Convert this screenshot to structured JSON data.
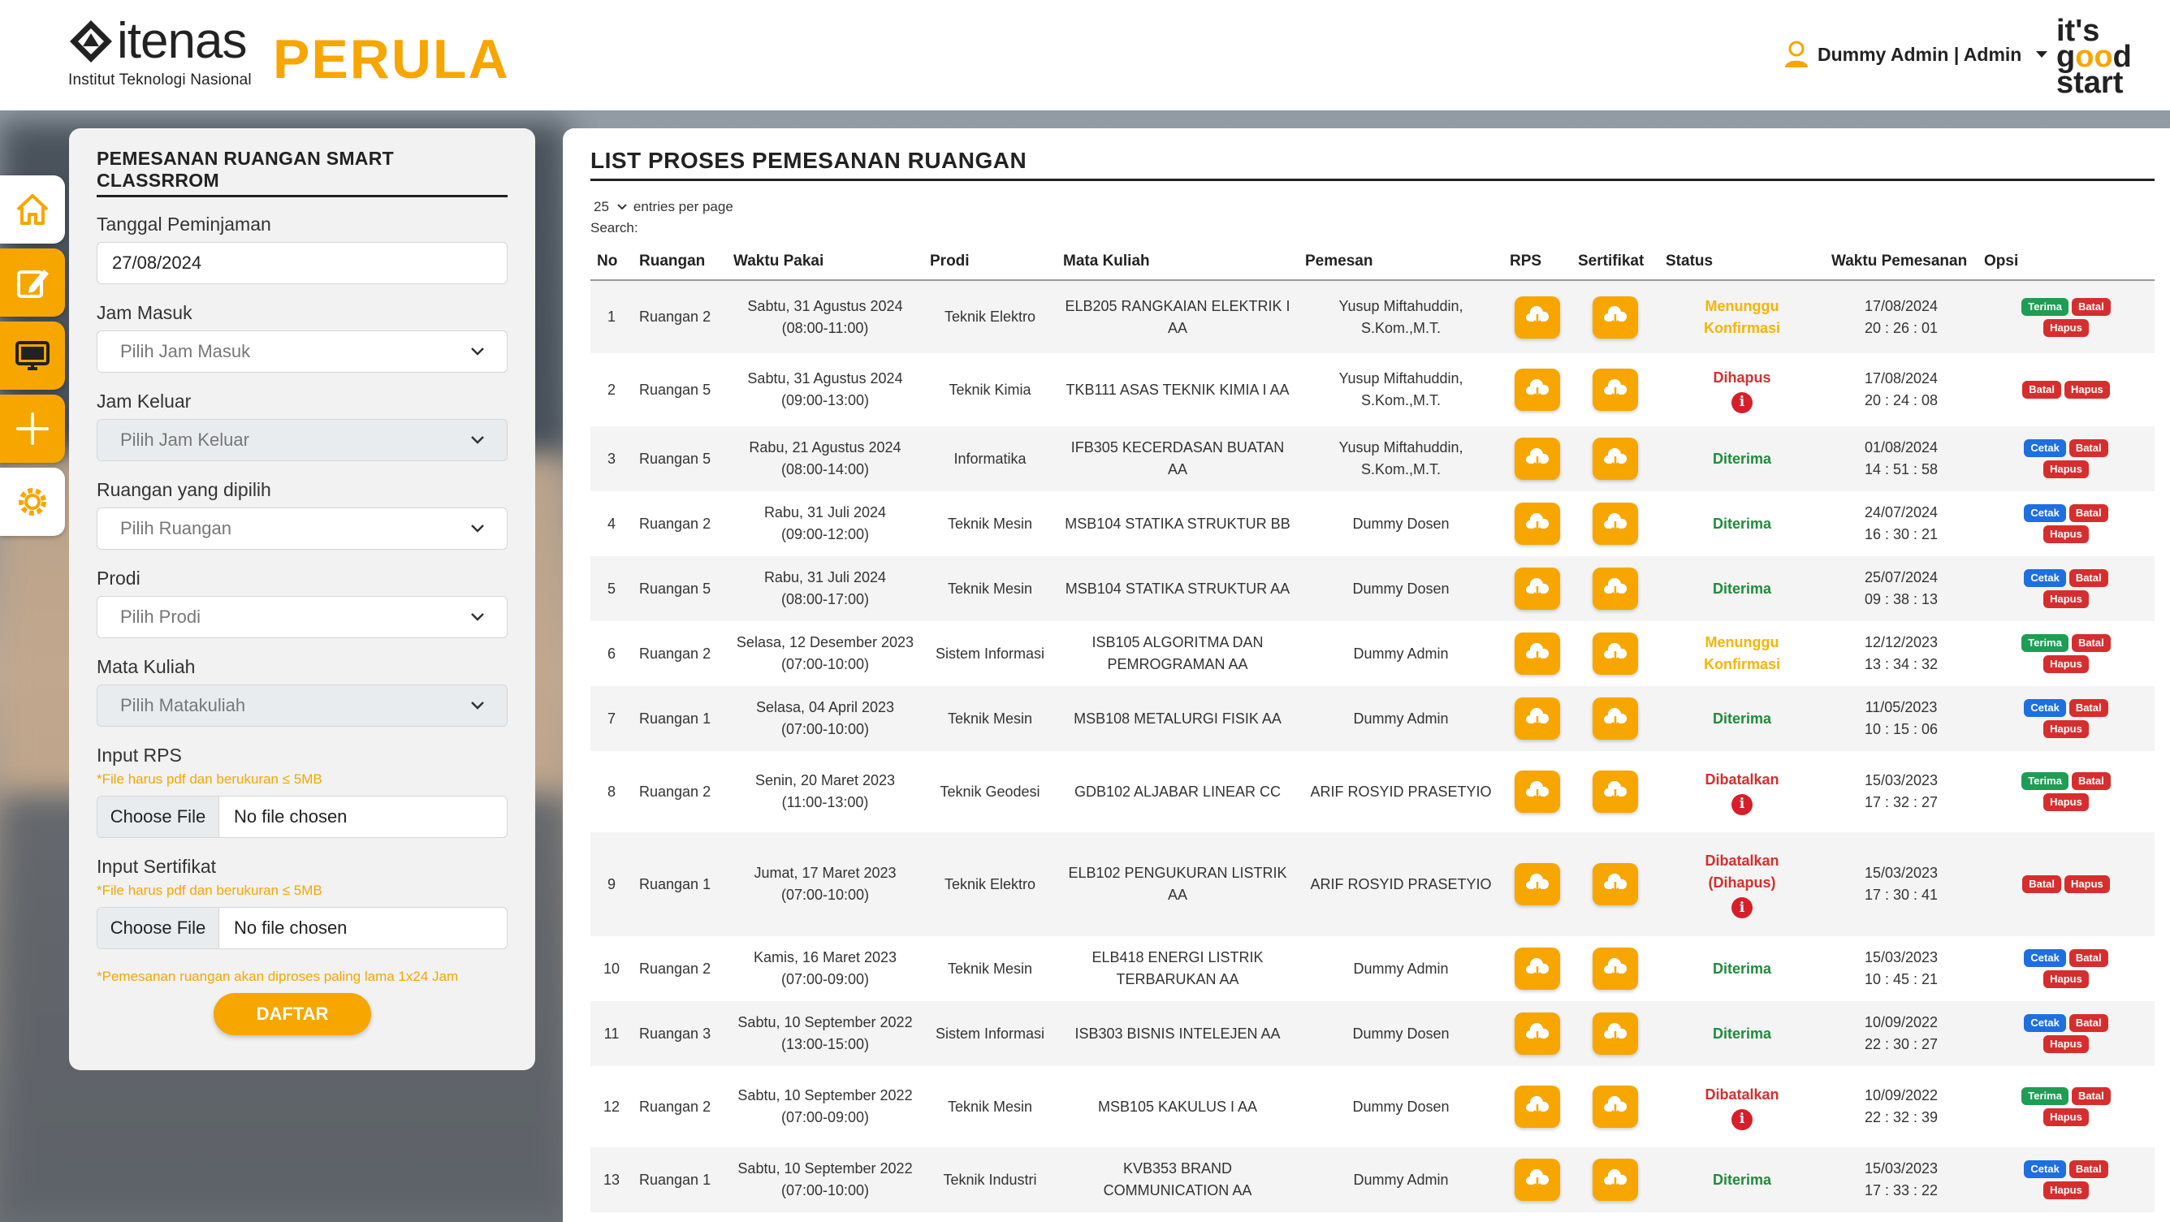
{
  "header": {
    "logo_text": "itenas",
    "logo_subtitle": "Institut Teknologi Nasional",
    "app_title": "PERULA",
    "user_label": "Dummy Admin | Admin",
    "slogan": [
      "it's",
      "good",
      "start"
    ]
  },
  "sidenav": {
    "items": [
      {
        "icon": "home-icon"
      },
      {
        "icon": "edit-icon",
        "active": true
      },
      {
        "icon": "monitor-icon"
      },
      {
        "icon": "plus-icon"
      },
      {
        "icon": "gear-icon"
      }
    ]
  },
  "form": {
    "title": "PEMESANAN RUANGAN SMART CLASSRROM",
    "tanggal_label": "Tanggal Peminjaman",
    "tanggal_value": "27/08/2024",
    "jam_masuk_label": "Jam Masuk",
    "jam_masuk_placeholder": "Pilih Jam Masuk",
    "jam_keluar_label": "Jam Keluar",
    "jam_keluar_placeholder": "Pilih Jam Keluar",
    "ruangan_label": "Ruangan yang dipilih",
    "ruangan_placeholder": "Pilih Ruangan",
    "prodi_label": "Prodi",
    "prodi_placeholder": "Pilih Prodi",
    "matkul_label": "Mata Kuliah",
    "matkul_placeholder": "Pilih Matakuliah",
    "rps_label": "Input RPS",
    "rps_hint": "*File harus pdf dan berukuran ≤ 5MB",
    "sertifikat_label": "Input Sertifikat",
    "sertifikat_hint": "*File harus pdf dan berukuran ≤ 5MB",
    "choose_file": "Choose File",
    "no_file": "No file chosen",
    "note": "*Pemesanan ruangan akan diproses paling lama 1x24 Jam",
    "submit_label": "DAFTAR"
  },
  "list": {
    "title": "LIST PROSES PEMESANAN RUANGAN",
    "entries_value": "25",
    "entries_label": "entries per page",
    "search_label": "Search:",
    "columns": [
      "No",
      "Ruangan",
      "Waktu Pakai",
      "Prodi",
      "Mata Kuliah",
      "Pemesan",
      "RPS",
      "Sertifikat",
      "Status",
      "Waktu Pemesanan",
      "Opsi"
    ],
    "rows": [
      {
        "no": "1",
        "ruangan": "Ruangan 2",
        "waktu": [
          "Sabtu, 31 Agustus 2024",
          "(08:00-11:00)"
        ],
        "prodi": "Teknik Elektro",
        "matkul": [
          "ELB205 RANGKAIAN ELEKTRIK I",
          "AA"
        ],
        "pemesan": [
          "Yusup Miftahuddin,",
          "S.Kom.,M.T."
        ],
        "status": [
          "Menunggu",
          "Konfirmasi"
        ],
        "status_type": "wait",
        "info": false,
        "pesan": [
          "17/08/2024",
          "20 : 26 : 01"
        ],
        "opsi": [
          "Terima",
          "Batal",
          "Hapus"
        ]
      },
      {
        "no": "2",
        "ruangan": "Ruangan 5",
        "waktu": [
          "Sabtu, 31 Agustus 2024",
          "(09:00-13:00)"
        ],
        "prodi": "Teknik Kimia",
        "matkul": [
          "TKB111 ASAS TEKNIK KIMIA I AA"
        ],
        "pemesan": [
          "Yusup Miftahuddin,",
          "S.Kom.,M.T."
        ],
        "status": [
          "Dihapus"
        ],
        "status_type": "bad",
        "info": true,
        "pesan": [
          "17/08/2024",
          "20 : 24 : 08"
        ],
        "opsi": [
          "Batal",
          "Hapus"
        ]
      },
      {
        "no": "3",
        "ruangan": "Ruangan 5",
        "waktu": [
          "Rabu, 21 Agustus 2024",
          "(08:00-14:00)"
        ],
        "prodi": "Informatika",
        "matkul": [
          "IFB305 KECERDASAN BUATAN",
          "AA"
        ],
        "pemesan": [
          "Yusup Miftahuddin,",
          "S.Kom.,M.T."
        ],
        "status": [
          "Diterima"
        ],
        "status_type": "ok",
        "info": false,
        "pesan": [
          "01/08/2024",
          "14 : 51 : 58"
        ],
        "opsi": [
          "Cetak",
          "Batal",
          "Hapus"
        ]
      },
      {
        "no": "4",
        "ruangan": "Ruangan 2",
        "waktu": [
          "Rabu, 31 Juli 2024",
          "(09:00-12:00)"
        ],
        "prodi": "Teknik Mesin",
        "matkul": [
          "MSB104 STATIKA STRUKTUR BB"
        ],
        "pemesan": [
          "Dummy Dosen"
        ],
        "status": [
          "Diterima"
        ],
        "status_type": "ok",
        "info": false,
        "pesan": [
          "24/07/2024",
          "16 : 30 : 21"
        ],
        "opsi": [
          "Cetak",
          "Batal",
          "Hapus"
        ]
      },
      {
        "no": "5",
        "ruangan": "Ruangan 5",
        "waktu": [
          "Rabu, 31 Juli 2024",
          "(08:00-17:00)"
        ],
        "prodi": "Teknik Mesin",
        "matkul": [
          "MSB104 STATIKA STRUKTUR AA"
        ],
        "pemesan": [
          "Dummy Dosen"
        ],
        "status": [
          "Diterima"
        ],
        "status_type": "ok",
        "info": false,
        "pesan": [
          "25/07/2024",
          "09 : 38 : 13"
        ],
        "opsi": [
          "Cetak",
          "Batal",
          "Hapus"
        ]
      },
      {
        "no": "6",
        "ruangan": "Ruangan 2",
        "waktu": [
          "Selasa, 12 Desember 2023",
          "(07:00-10:00)"
        ],
        "prodi": "Sistem Informasi",
        "matkul": [
          "ISB105 ALGORITMA DAN",
          "PEMROGRAMAN AA"
        ],
        "pemesan": [
          "Dummy Admin"
        ],
        "status": [
          "Menunggu",
          "Konfirmasi"
        ],
        "status_type": "wait",
        "info": false,
        "pesan": [
          "12/12/2023",
          "13 : 34 : 32"
        ],
        "opsi": [
          "Terima",
          "Batal",
          "Hapus"
        ]
      },
      {
        "no": "7",
        "ruangan": "Ruangan 1",
        "waktu": [
          "Selasa, 04 April 2023",
          "(07:00-10:00)"
        ],
        "prodi": "Teknik Mesin",
        "matkul": [
          "MSB108 METALURGI FISIK AA"
        ],
        "pemesan": [
          "Dummy Admin"
        ],
        "status": [
          "Diterima"
        ],
        "status_type": "ok",
        "info": false,
        "pesan": [
          "11/05/2023",
          "10 : 15 : 06"
        ],
        "opsi": [
          "Cetak",
          "Batal",
          "Hapus"
        ]
      },
      {
        "no": "8",
        "ruangan": "Ruangan 2",
        "waktu": [
          "Senin, 20 Maret 2023",
          "(11:00-13:00)"
        ],
        "prodi": "Teknik Geodesi",
        "matkul": [
          "GDB102 ALJABAR LINEAR CC"
        ],
        "pemesan": [
          "ARIF ROSYID PRASETYIO"
        ],
        "status": [
          "Dibatalkan"
        ],
        "status_type": "bad",
        "info": true,
        "pesan": [
          "15/03/2023",
          "17 : 32 : 27"
        ],
        "opsi": [
          "Terima",
          "Batal",
          "Hapus"
        ]
      },
      {
        "no": "9",
        "ruangan": "Ruangan 1",
        "waktu": [
          "Jumat, 17 Maret 2023",
          "(07:00-10:00)"
        ],
        "prodi": "Teknik Elektro",
        "matkul": [
          "ELB102 PENGUKURAN LISTRIK",
          "AA"
        ],
        "pemesan": [
          "ARIF ROSYID PRASETYIO"
        ],
        "status": [
          "Dibatalkan",
          "(Dihapus)"
        ],
        "status_type": "bad",
        "info": true,
        "pesan": [
          "15/03/2023",
          "17 : 30 : 41"
        ],
        "opsi": [
          "Batal",
          "Hapus"
        ]
      },
      {
        "no": "10",
        "ruangan": "Ruangan 2",
        "waktu": [
          "Kamis, 16 Maret 2023",
          "(07:00-09:00)"
        ],
        "prodi": "Teknik Mesin",
        "matkul": [
          "ELB418 ENERGI LISTRIK",
          "TERBARUKAN AA"
        ],
        "pemesan": [
          "Dummy Admin"
        ],
        "status": [
          "Diterima"
        ],
        "status_type": "ok",
        "info": false,
        "pesan": [
          "15/03/2023",
          "10 : 45 : 21"
        ],
        "opsi": [
          "Cetak",
          "Batal",
          "Hapus"
        ]
      },
      {
        "no": "11",
        "ruangan": "Ruangan 3",
        "waktu": [
          "Sabtu, 10 September 2022",
          "(13:00-15:00)"
        ],
        "prodi": "Sistem Informasi",
        "matkul": [
          "ISB303 BISNIS INTELEJEN AA"
        ],
        "pemesan": [
          "Dummy Dosen"
        ],
        "status": [
          "Diterima"
        ],
        "status_type": "ok",
        "info": false,
        "pesan": [
          "10/09/2022",
          "22 : 30 : 27"
        ],
        "opsi": [
          "Cetak",
          "Batal",
          "Hapus"
        ]
      },
      {
        "no": "12",
        "ruangan": "Ruangan 2",
        "waktu": [
          "Sabtu, 10 September 2022",
          "(07:00-09:00)"
        ],
        "prodi": "Teknik Mesin",
        "matkul": [
          "MSB105 KAKULUS I AA"
        ],
        "pemesan": [
          "Dummy Dosen"
        ],
        "status": [
          "Dibatalkan"
        ],
        "status_type": "bad",
        "info": true,
        "pesan": [
          "10/09/2022",
          "22 : 32 : 39"
        ],
        "opsi": [
          "Terima",
          "Batal",
          "Hapus"
        ]
      },
      {
        "no": "13",
        "ruangan": "Ruangan 1",
        "waktu": [
          "Sabtu, 10 September 2022",
          "(07:00-10:00)"
        ],
        "prodi": "Teknik Industri",
        "matkul": [
          "KVB353 BRAND",
          "COMMUNICATION AA"
        ],
        "pemesan": [
          "Dummy Admin"
        ],
        "status": [
          "Diterima"
        ],
        "status_type": "ok",
        "info": false,
        "pesan": [
          "15/03/2023",
          "17 : 33 : 22"
        ],
        "opsi": [
          "Cetak",
          "Batal",
          "Hapus"
        ]
      }
    ]
  },
  "colors": {
    "accent": "#f7a600",
    "ok": "#1e8c3a",
    "bad": "#d62e2e",
    "wait": "#f7b500",
    "cetak": "#1e6fe0"
  }
}
